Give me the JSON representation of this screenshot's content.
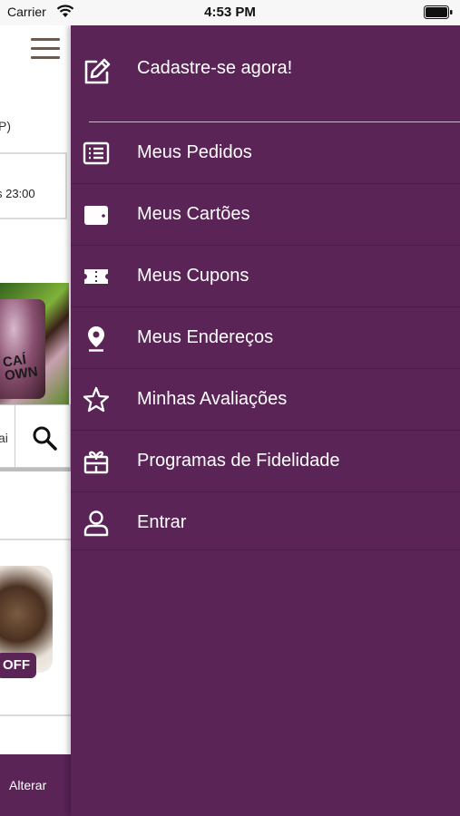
{
  "status_bar": {
    "carrier": "Carrier",
    "time": "4:53 PM"
  },
  "background": {
    "partial_text_p": "P)",
    "partial_hours": "s 23:00",
    "image_text_line1": "CAÍ",
    "image_text_line2": "OWN",
    "partial_search_text": "ai",
    "off_badge": "OFF",
    "alterar": "Alterar"
  },
  "drawer": {
    "register": {
      "label": "Cadastre-se agora!",
      "icon": "edit-icon"
    },
    "items": [
      {
        "label": "Meus Pedidos",
        "icon": "list-icon"
      },
      {
        "label": "Meus Cartões",
        "icon": "wallet-icon"
      },
      {
        "label": "Meus Cupons",
        "icon": "ticket-icon"
      },
      {
        "label": "Meus Endereços",
        "icon": "location-pin-icon"
      },
      {
        "label": "Minhas Avaliações",
        "icon": "star-icon"
      },
      {
        "label": "Programas de Fidelidade",
        "icon": "gift-icon"
      },
      {
        "label": "Entrar",
        "icon": "user-icon"
      }
    ]
  },
  "colors": {
    "drawer_bg": "#5a2457",
    "text": "#ffffff"
  }
}
